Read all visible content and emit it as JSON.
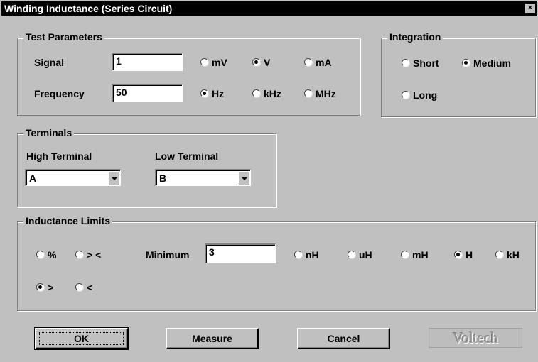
{
  "window": {
    "title": "Winding Inductance (Series Circuit)",
    "close_glyph": "×"
  },
  "test_parameters": {
    "legend": "Test Parameters",
    "signal_label": "Signal",
    "signal_value": "1",
    "signal_units": [
      {
        "label": "mV",
        "selected": false
      },
      {
        "label": "V",
        "selected": true
      },
      {
        "label": "mA",
        "selected": false
      }
    ],
    "frequency_label": "Frequency",
    "frequency_value": "50",
    "frequency_units": [
      {
        "label": "Hz",
        "selected": true
      },
      {
        "label": "kHz",
        "selected": false
      },
      {
        "label": "MHz",
        "selected": false
      }
    ]
  },
  "integration": {
    "legend": "Integration",
    "options": [
      {
        "label": "Short",
        "selected": false
      },
      {
        "label": "Medium",
        "selected": true
      },
      {
        "label": "Long",
        "selected": false
      }
    ]
  },
  "terminals": {
    "legend": "Terminals",
    "high_label": "High Terminal",
    "high_value": "A",
    "low_label": "Low Terminal",
    "low_value": "B"
  },
  "limits": {
    "legend": "Inductance Limits",
    "mode_options": [
      {
        "label": "%",
        "selected": false
      },
      {
        "label": "> <",
        "selected": false
      },
      {
        "label": ">",
        "selected": true
      },
      {
        "label": "<",
        "selected": false
      }
    ],
    "minimum_label": "Minimum",
    "minimum_value": "3",
    "units": [
      {
        "label": "nH",
        "selected": false
      },
      {
        "label": "uH",
        "selected": false
      },
      {
        "label": "mH",
        "selected": false
      },
      {
        "label": "H",
        "selected": true
      },
      {
        "label": "kH",
        "selected": false
      }
    ]
  },
  "buttons": {
    "ok": "OK",
    "measure": "Measure",
    "cancel": "Cancel"
  },
  "logo": {
    "text": "Voltech"
  }
}
